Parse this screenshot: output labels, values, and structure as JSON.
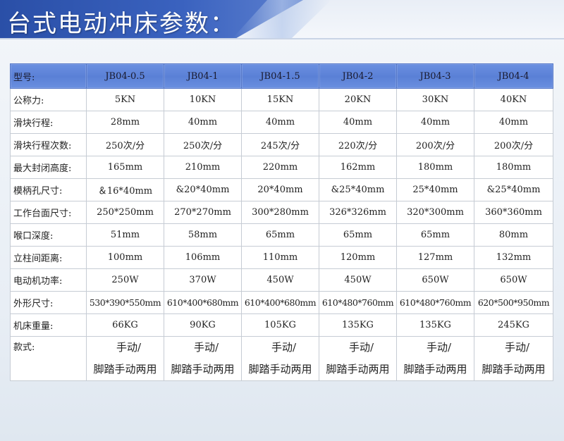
{
  "page": {
    "title": "台式电动冲床参数："
  },
  "table": {
    "header": {
      "label": "型号:",
      "models": [
        "JB04-0.5",
        "JB04-1",
        "JB04-1.5",
        "JB04-2",
        "JB04-3",
        "JB04-4"
      ]
    },
    "rows": [
      {
        "label": "公称力:",
        "values": [
          "5KN",
          "10KN",
          "15KN",
          "20KN",
          "30KN",
          "40KN"
        ]
      },
      {
        "label": "滑块行程:",
        "values": [
          "28mm",
          "40mm",
          "40mm",
          "40mm",
          "40mm",
          "40mm"
        ]
      },
      {
        "label": "滑块行程次数:",
        "values": [
          "250次/分",
          "250次/分",
          "245次/分",
          "220次/分",
          "200次/分",
          "200次/分"
        ]
      },
      {
        "label": "最大封闭高度:",
        "values": [
          "165mm",
          "210mm",
          "220mm",
          "162mm",
          "180mm",
          "180mm"
        ]
      },
      {
        "label": "模柄孔尺寸:",
        "values": [
          "＆16*40mm",
          "&20*40mm",
          "20*40mm",
          "&25*40mm",
          "25*40mm",
          "&25*40mm"
        ]
      },
      {
        "label": "工作台面尺寸:",
        "values": [
          "250*250mm",
          "270*270mm",
          "300*280mm",
          "326*326mm",
          "320*300mm",
          "360*360mm"
        ]
      },
      {
        "label": "喉口深度:",
        "values": [
          "51mm",
          "58mm",
          "65mm",
          "65mm",
          "65mm",
          "80mm"
        ]
      },
      {
        "label": "立柱间距离:",
        "values": [
          "100mm",
          "106mm",
          "110mm",
          "120mm",
          "127mm",
          "132mm"
        ]
      },
      {
        "label": "电动机功率:",
        "values": [
          "250W",
          "370W",
          "450W",
          "450W",
          "650W",
          "650W"
        ]
      },
      {
        "label": "外形尺寸:",
        "values": [
          "530*390*550mm",
          "610*400*680mm",
          "610*400*680mm",
          "610*480*760mm",
          "610*480*760mm",
          "620*500*950mm"
        ]
      },
      {
        "label": "机床重量:",
        "values": [
          "66KG",
          "90KG",
          "105KG",
          "135KG",
          "135KG",
          "245KG"
        ]
      }
    ],
    "style_row": {
      "label": "款式:",
      "line1": "手动/",
      "line2": "脚踏手动两用"
    }
  },
  "colors": {
    "header_band": "#2a4fa7",
    "table_header": "#6a8fe0",
    "border": "#c6ccd4"
  }
}
